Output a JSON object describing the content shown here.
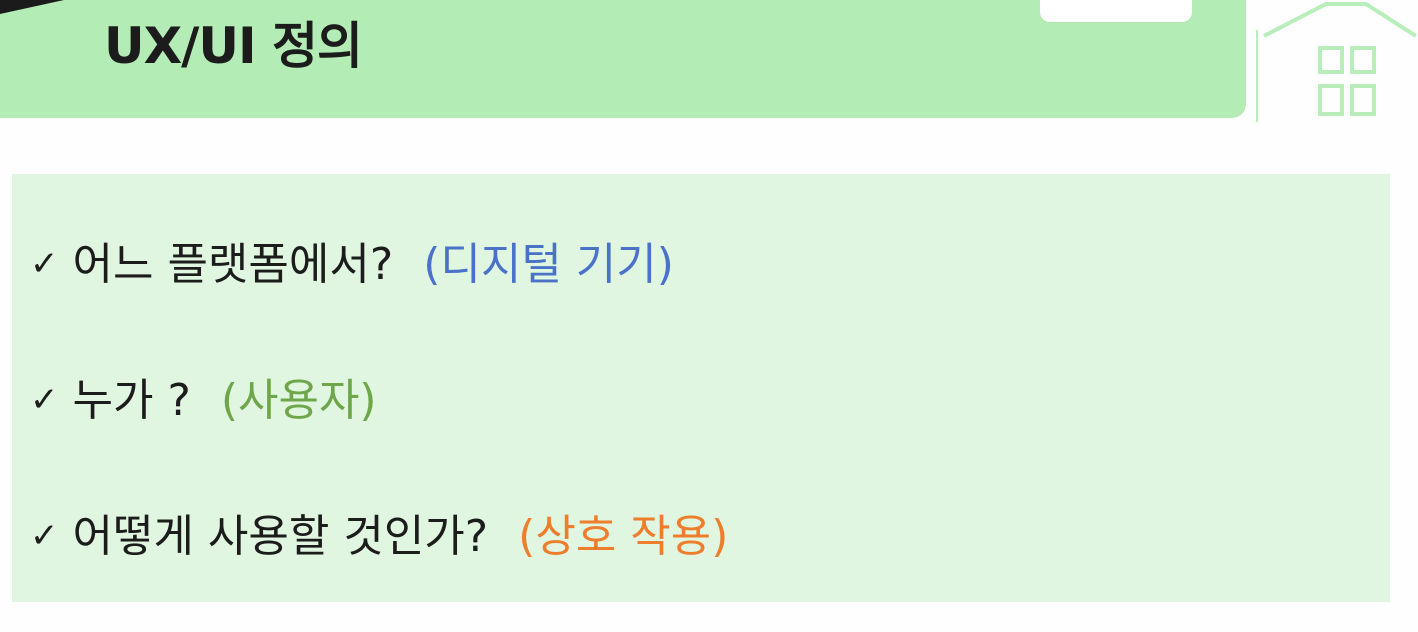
{
  "header": {
    "title": "UX/UI 정의"
  },
  "checklist": [
    {
      "question": "어느 플랫폼에서?",
      "note": "(디지털 기기)",
      "note_color": "#4a72c8",
      "icon": "check-icon"
    },
    {
      "question": "누가 ?",
      "note": "(사용자)",
      "note_color": "#6ea64a",
      "icon": "check-icon"
    },
    {
      "question": "어떻게 사용할 것인가?",
      "note": "(상호 작용)",
      "note_color": "#ee7d2c",
      "icon": "check-icon"
    }
  ],
  "colors": {
    "banner": "#b4ecb6",
    "content_box": "#e1f6e1",
    "house": "#b8eeba"
  }
}
